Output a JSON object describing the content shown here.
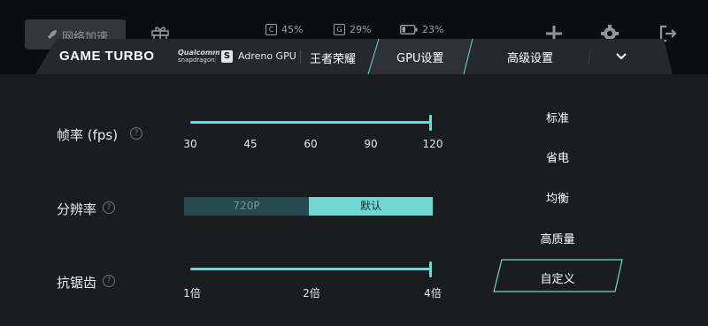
{
  "top_bar": {
    "network_boost_label": "网络加速",
    "cpu_badge": "C",
    "cpu_value": "45%",
    "gpu_badge": "G",
    "gpu_value": "29%",
    "battery_value": "23%"
  },
  "header": {
    "brand": "GAME TURBO",
    "qualcomm_line1": "Qualcomm",
    "qualcomm_line2": "snapdragon",
    "snapdragon_glyph": "S",
    "gpu_name": "Adreno GPU",
    "game_name": "王者荣耀",
    "tabs": [
      {
        "label": "GPU设置",
        "active": true
      },
      {
        "label": "高级设置",
        "active": false
      }
    ]
  },
  "settings": {
    "framerate": {
      "label": "帧率 (fps)",
      "ticks": [
        "30",
        "45",
        "60",
        "90",
        "120"
      ],
      "selected": "120"
    },
    "resolution": {
      "label": "分辨率",
      "options": [
        "720P",
        "默认"
      ],
      "selected": "默认"
    },
    "antialiasing": {
      "label": "抗锯齿",
      "ticks": [
        "1倍",
        "2倍",
        "4倍"
      ],
      "selected": "4倍"
    },
    "help_glyph": "?"
  },
  "presets": {
    "items": [
      "标准",
      "省电",
      "均衡",
      "高质量",
      "自定义"
    ],
    "selected": "自定义"
  },
  "colors": {
    "accent": "#5ee0dc",
    "panel": "#1a1c1f",
    "background": "#0b0d0f"
  }
}
